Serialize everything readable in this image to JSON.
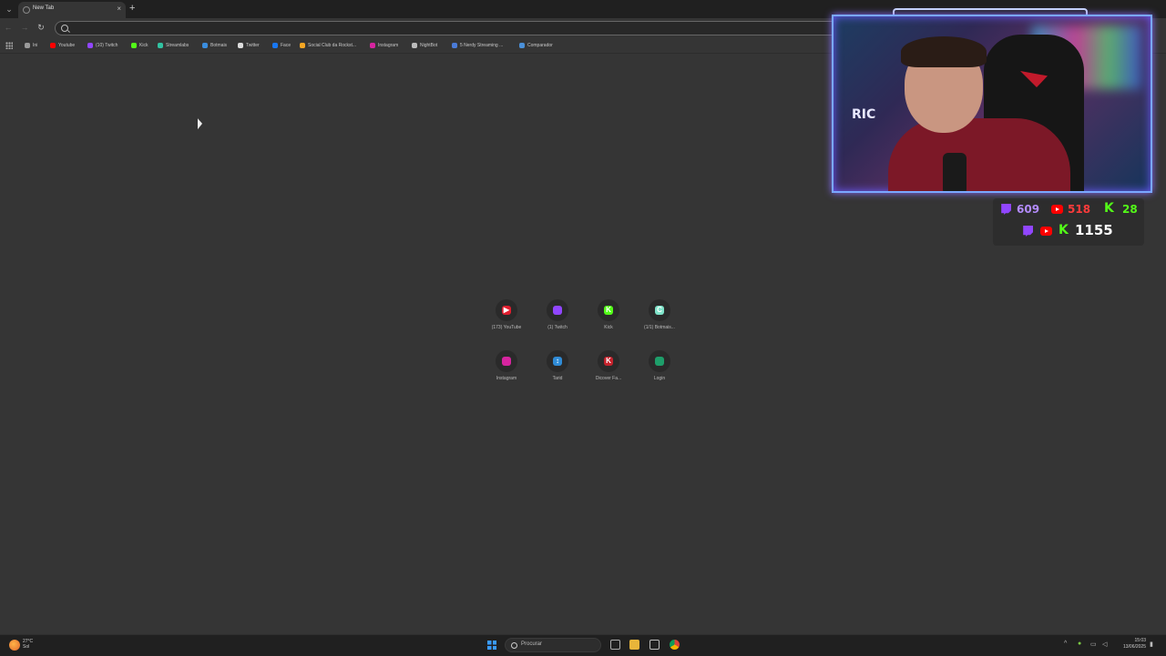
{
  "browser": {
    "tab_title": "New Tab",
    "tab_close": "×",
    "new_tab": "+",
    "omnibox_placeholder": ""
  },
  "bookmarks": [
    {
      "label": "Ini",
      "color": "#9a9a9a"
    },
    {
      "label": "Youtube",
      "color": "#ff0000"
    },
    {
      "label": "(10) Twitch",
      "color": "#9146ff"
    },
    {
      "label": "Kick",
      "color": "#53fc18"
    },
    {
      "label": "Streamlabs",
      "color": "#31c3a2"
    },
    {
      "label": "Botmais",
      "color": "#3a8dde"
    },
    {
      "label": "Twitter",
      "color": "#dddddd"
    },
    {
      "label": "Face",
      "color": "#1877f2"
    },
    {
      "label": "Social Club da Rockst...",
      "color": "#f5a623"
    },
    {
      "label": "Instagram",
      "color": "#d6249f"
    },
    {
      "label": "NightBot",
      "color": "#bbbbbb"
    },
    {
      "label": "5 Nerdy Streaming ...",
      "color": "#4a7bd8"
    },
    {
      "label": "Comparador",
      "color": "#4a90d9"
    }
  ],
  "shortcuts": [
    {
      "label": "(173) YouTube",
      "color": "#e01e2f",
      "glyph": "▶"
    },
    {
      "label": "(1) Twitch",
      "color": "#9146ff",
      "glyph": ""
    },
    {
      "label": "Kick",
      "color": "#53fc18",
      "glyph": "K"
    },
    {
      "label": "(1/1) Botmais...",
      "color": "#7fe3c9",
      "glyph": "C"
    },
    {
      "label": "Instagram",
      "color": "#d6249f",
      "glyph": ""
    },
    {
      "label": "Tarid",
      "color": "#2f8bd6",
      "glyph": "↕"
    },
    {
      "label": "Dicover Fa...",
      "color": "#c5222c",
      "glyph": "K"
    },
    {
      "label": "Login",
      "color": "#1e9e6a",
      "glyph": ""
    }
  ],
  "stream_stats": {
    "twitch": "609",
    "youtube": "518",
    "kick": "28",
    "total": "1155"
  },
  "webcam": {
    "sign": "RIC"
  },
  "taskbar": {
    "weather_temp": "27°C",
    "weather_desc": "Sol",
    "search_placeholder": "Procurar",
    "time": "15:03",
    "date": "13/06/2025"
  }
}
